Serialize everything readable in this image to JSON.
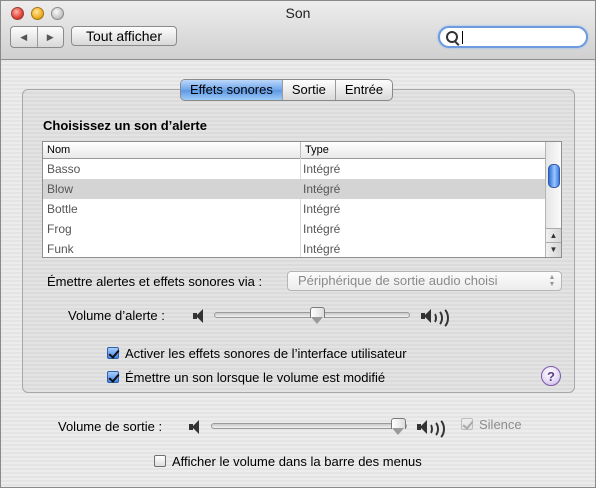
{
  "window": {
    "title": "Son"
  },
  "toolbar": {
    "back_glyph": "◀",
    "forward_glyph": "▶",
    "show_all_label": "Tout afficher",
    "search_value": ""
  },
  "tabs": [
    {
      "label": "Effets sonores",
      "active": true
    },
    {
      "label": "Sortie",
      "active": false
    },
    {
      "label": "Entrée",
      "active": false
    }
  ],
  "alerts": {
    "heading": "Choisissez un son d’alerte",
    "columns": {
      "name": "Nom",
      "type": "Type"
    },
    "rows": [
      {
        "name": "Basso",
        "type": "Intégré",
        "selected": false
      },
      {
        "name": "Blow",
        "type": "Intégré",
        "selected": true
      },
      {
        "name": "Bottle",
        "type": "Intégré",
        "selected": false
      },
      {
        "name": "Frog",
        "type": "Intégré",
        "selected": false
      },
      {
        "name": "Funk",
        "type": "Intégré",
        "selected": false
      }
    ],
    "scroll_up_glyph": "▲",
    "scroll_down_glyph": "▼"
  },
  "output_via": {
    "label": "Émettre alertes et effets sonores via :",
    "value": "Périphérique de sortie audio choisi"
  },
  "alert_volume": {
    "label": "Volume d’alerte :",
    "level": 0.57
  },
  "checkboxes": {
    "ui_effects": {
      "label": "Activer les effets sonores de l’interface utilisateur",
      "checked": true
    },
    "volume_feedback": {
      "label": "Émettre un son lorsque le volume est modifié",
      "checked": true
    }
  },
  "help": {
    "glyph": "?"
  },
  "output_volume": {
    "label": "Volume de sortie :",
    "level": 1.0
  },
  "mute": {
    "label": "Silence",
    "checked": true,
    "enabled": false
  },
  "menu_bar_volume": {
    "label": "Afficher le volume dans la barre des menus",
    "checked": false
  },
  "colors": {
    "accent": "#5b97e4",
    "help_purple": "#7c5aa8"
  }
}
